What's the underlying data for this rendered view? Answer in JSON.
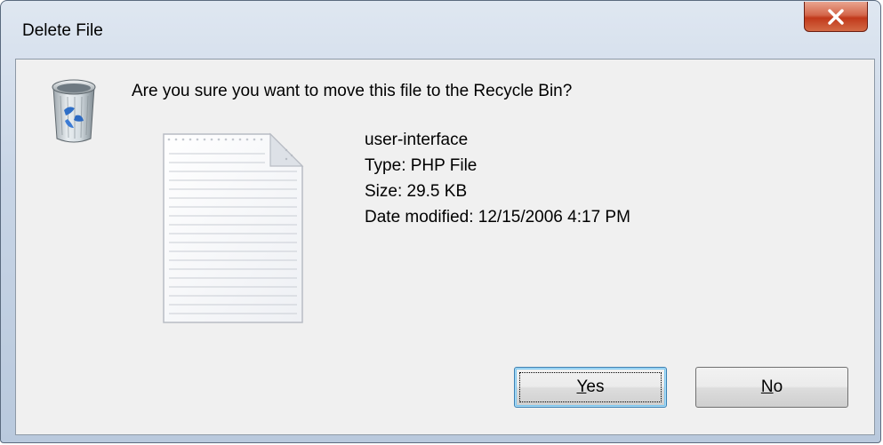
{
  "window": {
    "title": "Delete File"
  },
  "dialog": {
    "question": "Are you sure you want to move this file to the Recycle Bin?",
    "icon": "recycle-bin-icon",
    "file_icon": "document-icon"
  },
  "file": {
    "name": "user-interface",
    "type": "Type: PHP File",
    "size": "Size: 29.5 KB",
    "date_modified": "Date modified: 12/15/2006 4:17 PM"
  },
  "buttons": {
    "yes": {
      "mnemonic": "Y",
      "rest": "es",
      "default": true
    },
    "no": {
      "mnemonic": "N",
      "rest": "o"
    }
  },
  "colors": {
    "close_button": "#c1391b",
    "frame": "#c8d5e6",
    "client_background": "#f0f0f0",
    "default_button_border": "#3c7fb1"
  }
}
